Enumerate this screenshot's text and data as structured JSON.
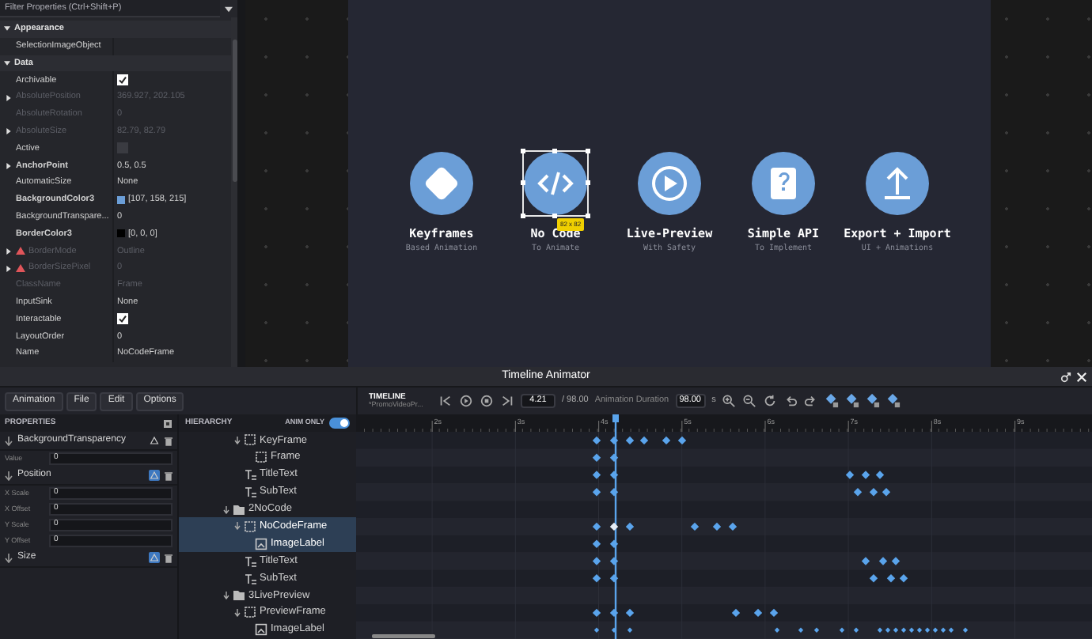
{
  "properties_filter": {
    "placeholder": "Filter Properties (Ctrl+Shift+P)"
  },
  "properties": [
    {
      "kind": "section",
      "label": "Appearance",
      "expanded": true
    },
    {
      "kind": "text",
      "label": "SelectionImageObject",
      "disabled": false,
      "modified": false,
      "expandable": false,
      "warning": false
    },
    {
      "kind": "section",
      "label": "Data",
      "expanded": true
    },
    {
      "kind": "checkbox",
      "label": "Archivable",
      "checked": true,
      "disabled": false,
      "modified": false,
      "expandable": false,
      "warning": false
    },
    {
      "kind": "text",
      "label": "AbsolutePosition",
      "value": "369.927, 202.105",
      "disabled": true,
      "modified": false,
      "expandable": true,
      "warning": false
    },
    {
      "kind": "text",
      "label": "AbsoluteRotation",
      "value": "0",
      "disabled": true,
      "modified": false,
      "expandable": false,
      "warning": false
    },
    {
      "kind": "text",
      "label": "AbsoluteSize",
      "value": "82.79, 82.79",
      "disabled": true,
      "modified": false,
      "expandable": true,
      "warning": false
    },
    {
      "kind": "checkbox",
      "label": "Active",
      "checked": false,
      "disabled": false,
      "modified": false,
      "expandable": false,
      "warning": false
    },
    {
      "kind": "text",
      "label": "AnchorPoint",
      "value": "0.5, 0.5",
      "disabled": false,
      "modified": true,
      "expandable": true,
      "warning": false
    },
    {
      "kind": "text",
      "label": "AutomaticSize",
      "value": "None",
      "disabled": false,
      "modified": false,
      "expandable": false,
      "warning": false
    },
    {
      "kind": "color",
      "label": "BackgroundColor3",
      "value": "[107, 158, 215]",
      "color": "#6b9ed7",
      "disabled": false,
      "modified": true,
      "expandable": false,
      "warning": false
    },
    {
      "kind": "text",
      "label": "BackgroundTranspare...",
      "value": "0",
      "disabled": false,
      "modified": false,
      "expandable": false,
      "warning": false
    },
    {
      "kind": "color",
      "label": "BorderColor3",
      "value": "[0, 0, 0]",
      "color": "#000000",
      "disabled": false,
      "modified": true,
      "expandable": false,
      "warning": false
    },
    {
      "kind": "text",
      "label": "BorderMode",
      "value": "Outline",
      "disabled": true,
      "modified": false,
      "expandable": true,
      "warning": true
    },
    {
      "kind": "text",
      "label": "BorderSizePixel",
      "value": "0",
      "disabled": true,
      "modified": false,
      "expandable": true,
      "warning": true
    },
    {
      "kind": "text",
      "label": "ClassName",
      "value": "Frame",
      "disabled": true,
      "modified": false,
      "expandable": false,
      "warning": false
    },
    {
      "kind": "text",
      "label": "InputSink",
      "value": "None",
      "disabled": false,
      "modified": false,
      "expandable": false,
      "warning": false
    },
    {
      "kind": "checkbox",
      "label": "Interactable",
      "checked": true,
      "disabled": false,
      "modified": false,
      "expandable": false,
      "warning": false
    },
    {
      "kind": "text",
      "label": "LayoutOrder",
      "value": "0",
      "disabled": false,
      "modified": false,
      "expandable": false,
      "warning": false
    },
    {
      "kind": "text",
      "label": "Name",
      "value": "NoCodeFrame",
      "disabled": false,
      "modified": false,
      "expandable": false,
      "warning": false
    }
  ],
  "canvas": {
    "features": [
      {
        "title": "Keyframes",
        "subtitle": "Based Animation",
        "selected": false
      },
      {
        "title": "No Code",
        "subtitle": "To Animate",
        "selected": true,
        "size_badge": "82 x 82"
      },
      {
        "title": "Live-Preview",
        "subtitle": "With Safety",
        "selected": false
      },
      {
        "title": "Simple API",
        "subtitle": "To Implement",
        "selected": false
      },
      {
        "title": "Export + Import",
        "subtitle": "UI + Animations",
        "selected": false
      }
    ]
  },
  "animator": {
    "title": "Timeline Animator",
    "menu": [
      "Animation",
      "File",
      "Edit",
      "Options"
    ],
    "timeline": {
      "title": "TIMELINE",
      "file": "*PromoVideoPr...",
      "time": "4.21",
      "total": "/ 98.00",
      "duration_label": "Animation Duration",
      "duration": "98.00",
      "unit": "s",
      "ruler_labels": [
        "2s",
        "3s",
        "4s",
        "5s",
        "6s",
        "7s",
        "8s",
        "9s"
      ]
    },
    "properties": {
      "title": "PROPERTIES",
      "tracks": [
        {
          "name": "BackgroundTransparency",
          "active": false,
          "fields": [
            {
              "label": "Value",
              "value": "0"
            }
          ]
        },
        {
          "name": "Position",
          "active": true,
          "fields": [
            {
              "label": "X Scale",
              "value": "0"
            },
            {
              "label": "X Offset",
              "value": "0"
            },
            {
              "label": "Y Scale",
              "value": "0"
            },
            {
              "label": "Y Offset",
              "value": "0"
            }
          ]
        },
        {
          "name": "Size",
          "active": true
        }
      ]
    },
    "hierarchy": {
      "title": "HIERARCHY",
      "anim_only": {
        "label": "ANIM ONLY",
        "on": true
      },
      "items": [
        {
          "kind": "continued",
          "children": [
            {
              "kind": "frame",
              "name": "KeyFrame",
              "expanded": true,
              "selected": false,
              "children": [
                {
                  "kind": "frame",
                  "name": "Frame",
                  "selected": false
                }
              ]
            },
            {
              "kind": "text",
              "name": "TitleText",
              "selected": false
            },
            {
              "kind": "text",
              "name": "SubText",
              "selected": false
            }
          ]
        },
        {
          "kind": "folder",
          "name": "2NoCode",
          "expanded": true,
          "selected": false,
          "children": [
            {
              "kind": "frame",
              "name": "NoCodeFrame",
              "expanded": true,
              "selected": true,
              "children": [
                {
                  "kind": "image",
                  "name": "ImageLabel",
                  "selected": true
                }
              ]
            },
            {
              "kind": "text",
              "name": "TitleText",
              "selected": false
            },
            {
              "kind": "text",
              "name": "SubText",
              "selected": false
            }
          ]
        },
        {
          "kind": "folder",
          "name": "3LivePreview",
          "expanded": true,
          "selected": false,
          "children": [
            {
              "kind": "frame",
              "name": "PreviewFrame",
              "expanded": true,
              "selected": false,
              "children": [
                {
                  "kind": "image",
                  "name": "ImageLabel",
                  "selected": false
                }
              ]
            }
          ]
        }
      ]
    }
  }
}
